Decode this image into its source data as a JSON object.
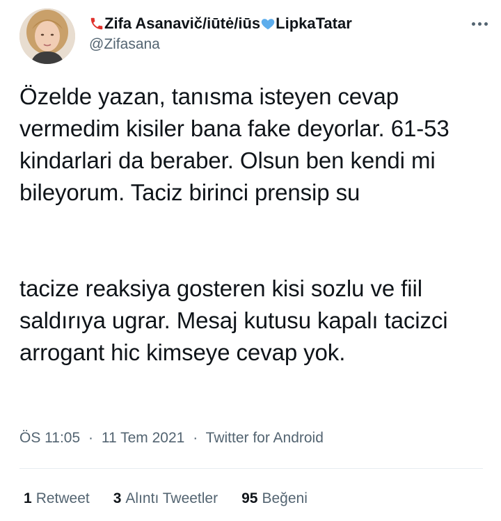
{
  "author": {
    "display_name_text": "Zifa Asanavič/iūtė/iūs",
    "display_name_suffix": "LipkaTatar",
    "handle": "@Zifasana",
    "emoji_prefix": "telephone-receiver-icon",
    "emoji_middle": "blue-heart-icon"
  },
  "tweet": {
    "paragraph1": "Özelde yazan, tanısma isteyen cevap vermedim kisiler bana fake deyorlar. 61-53 kindarlari da beraber. Olsun ben kendi mi bileyorum. Taciz birinci prensip su",
    "paragraph2": "tacize reaksiya gosteren kisi sozlu ve fiil saldırıya ugrar. Mesaj kutusu kapalı tacizci arrogant hic kimseye cevap yok."
  },
  "meta": {
    "time": "ÖS 11:05",
    "date": "11 Tem 2021",
    "separator": "·",
    "source": "Twitter for Android"
  },
  "stats": {
    "retweets_count": "1",
    "retweets_label": "Retweet",
    "quotes_count": "3",
    "quotes_label": "Alıntı Tweetler",
    "likes_count": "95",
    "likes_label": "Beğeni"
  },
  "colors": {
    "text_primary": "#0f1419",
    "text_secondary": "#536471",
    "heart_blue": "#5dadec",
    "divider": "#e6ecf0"
  }
}
